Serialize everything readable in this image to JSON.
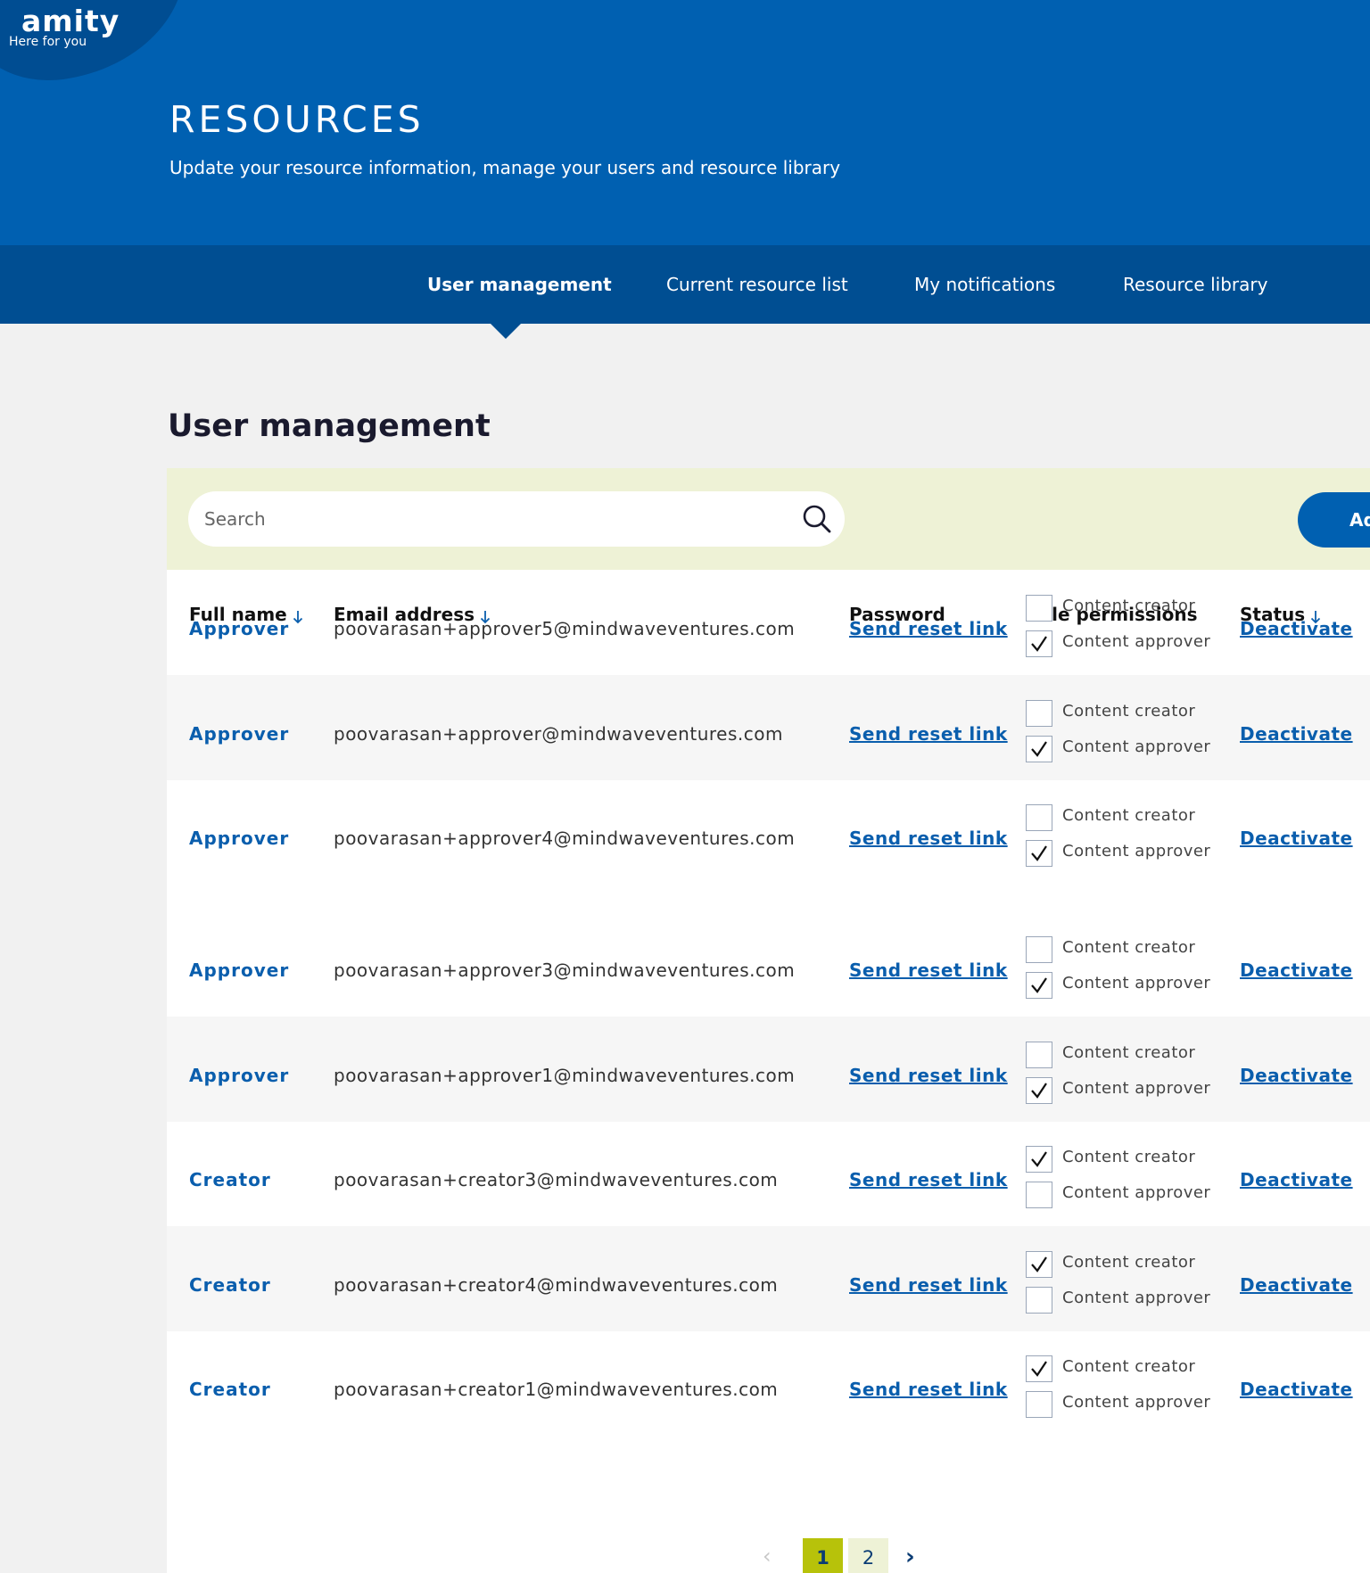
{
  "brand": {
    "name": "amity",
    "tagline": "Here for you"
  },
  "header": {
    "title": "RESOURCES",
    "subtitle": "Update your resource information, manage your users and resource library"
  },
  "tabs": [
    {
      "label": "User management",
      "active": true
    },
    {
      "label": "Current resource list",
      "active": false
    },
    {
      "label": "My notifications",
      "active": false
    },
    {
      "label": "Resource library",
      "active": false
    }
  ],
  "section": {
    "title": "User management"
  },
  "search": {
    "placeholder": "Search",
    "value": ""
  },
  "add_button": {
    "label": "Ad"
  },
  "columns": {
    "full_name": "Full name",
    "email": "Email address",
    "password": "Password",
    "role_permissions": "Role permissions",
    "status": "Status"
  },
  "permission_labels": {
    "creator": "Content creator",
    "approver": "Content approver"
  },
  "users": [
    {
      "name": "Approver",
      "email": "poovarasan+approver5@mindwaveventures.com",
      "reset": "Send reset link",
      "creator": false,
      "approver": true,
      "status_action": "Deactivate"
    },
    {
      "name": "Approver",
      "email": "poovarasan+approver@mindwaveventures.com",
      "reset": "Send reset link",
      "creator": false,
      "approver": true,
      "status_action": "Deactivate"
    },
    {
      "name": "Approver",
      "email": "poovarasan+approver4@mindwaveventures.com",
      "reset": "Send reset link",
      "creator": false,
      "approver": true,
      "status_action": "Deactivate"
    },
    {
      "name": "Approver",
      "email": "poovarasan+approver3@mindwaveventures.com",
      "reset": "Send reset link",
      "creator": false,
      "approver": true,
      "status_action": "Deactivate"
    },
    {
      "name": "Approver",
      "email": "poovarasan+approver1@mindwaveventures.com",
      "reset": "Send reset link",
      "creator": false,
      "approver": true,
      "status_action": "Deactivate"
    },
    {
      "name": "Creator",
      "email": "poovarasan+creator3@mindwaveventures.com",
      "reset": "Send reset link",
      "creator": true,
      "approver": false,
      "status_action": "Deactivate"
    },
    {
      "name": "Creator",
      "email": "poovarasan+creator4@mindwaveventures.com",
      "reset": "Send reset link",
      "creator": true,
      "approver": false,
      "status_action": "Deactivate"
    },
    {
      "name": "Creator",
      "email": "poovarasan+creator1@mindwaveventures.com",
      "reset": "Send reset link",
      "creator": true,
      "approver": false,
      "status_action": "Deactivate"
    }
  ],
  "pagination": {
    "prev": "‹",
    "pages": [
      "1",
      "2"
    ],
    "current": "1",
    "next": "›"
  },
  "colors": {
    "header_blue": "#0060b1",
    "tab_navy": "#004e92",
    "link_blue": "#0a5ead",
    "toolbar_bg": "#eef2d6",
    "page_active": "#b7c20a"
  }
}
